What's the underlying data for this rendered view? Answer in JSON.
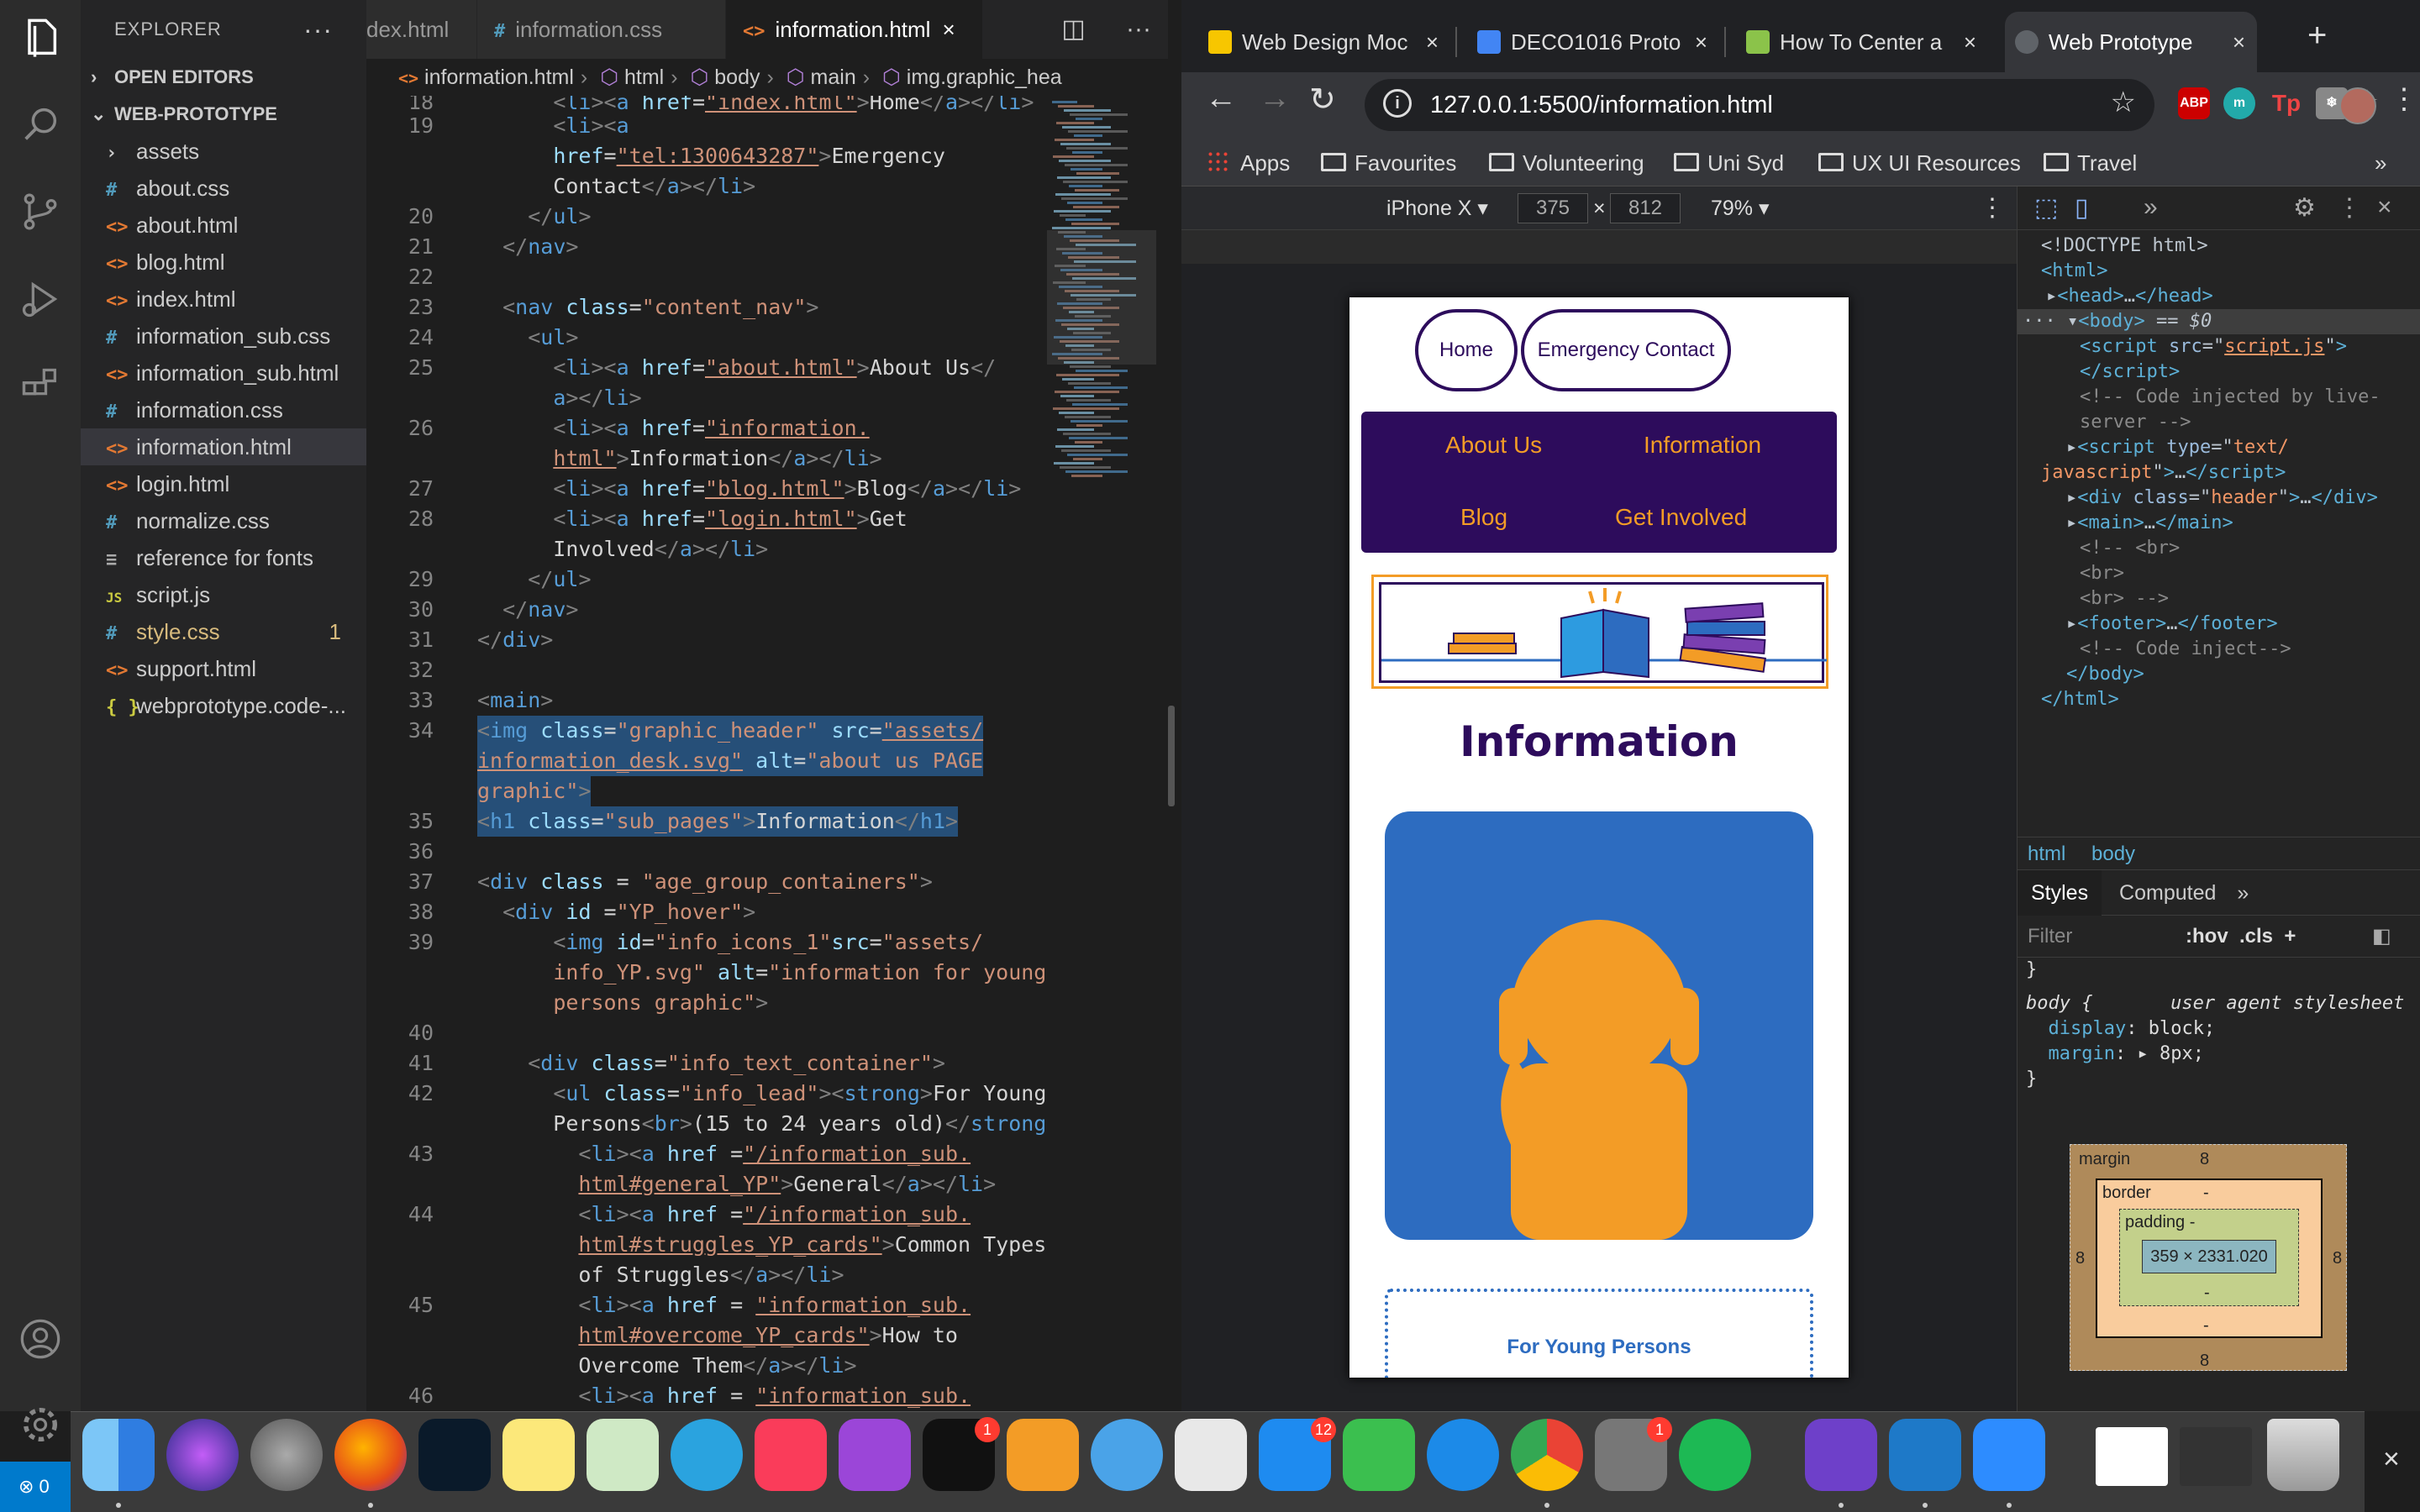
{
  "vscode": {
    "explorer_title": "EXPLORER",
    "open_editors": "OPEN EDITORS",
    "project": "WEB-PROTOTYPE",
    "files": [
      {
        "name": "assets",
        "type": "folder"
      },
      {
        "name": "about.css",
        "type": "css"
      },
      {
        "name": "about.html",
        "type": "html"
      },
      {
        "name": "blog.html",
        "type": "html"
      },
      {
        "name": "index.html",
        "type": "html"
      },
      {
        "name": "information_sub.css",
        "type": "css"
      },
      {
        "name": "information_sub.html",
        "type": "html"
      },
      {
        "name": "information.css",
        "type": "css"
      },
      {
        "name": "information.html",
        "type": "html"
      },
      {
        "name": "login.html",
        "type": "html"
      },
      {
        "name": "normalize.css",
        "type": "css"
      },
      {
        "name": "reference for fonts",
        "type": "txt"
      },
      {
        "name": "script.js",
        "type": "js"
      },
      {
        "name": "style.css",
        "type": "css",
        "badge": "1"
      },
      {
        "name": "support.html",
        "type": "html"
      },
      {
        "name": "webprototype.code-...",
        "type": "json"
      }
    ],
    "tabs": [
      {
        "label": "index.html",
        "icon": "<>",
        "partial": "dex.html"
      },
      {
        "label": "information.css",
        "icon": "#"
      },
      {
        "label": "information.html",
        "icon": "<>",
        "close": "×"
      }
    ],
    "breadcrumb": [
      "information.html",
      "html",
      "body",
      "main",
      "img.graphic_hea"
    ],
    "status": "⊗ 0"
  },
  "chrome": {
    "tabs": [
      {
        "title": "Web Design Moc",
        "color": "#f7c600"
      },
      {
        "title": "DECO1016 Proto",
        "color": "#4285f4"
      },
      {
        "title": "How To Center a",
        "color": "#8bc34a"
      },
      {
        "title": "Web Prototype",
        "color": "#5f6368"
      }
    ],
    "url": "127.0.0.1:5500/information.html",
    "extensions": [
      {
        "label": "ABP",
        "color": "#c00"
      },
      {
        "label": "m",
        "color": "#2aa"
      },
      {
        "label": "Tp",
        "color": "#e44"
      },
      {
        "label": "❄",
        "color": "#888"
      }
    ],
    "bookmarks": [
      "Apps",
      "Favourites",
      "Volunteering",
      "Uni Syd",
      "UX UI Resources",
      "Travel"
    ],
    "device": {
      "name": "iPhone X ▾",
      "width": "375",
      "x": "×",
      "height": "812",
      "zoom": "79% ▾"
    }
  },
  "page": {
    "nav_pills": [
      "Home",
      "Emergency Contact"
    ],
    "content_nav": [
      "About Us",
      "Information",
      "Blog",
      "Get Involved"
    ],
    "title": "Information",
    "yp_lead": "For Young Persons"
  },
  "devtools": {
    "crumbs": [
      "html",
      "body"
    ],
    "tabs": [
      "Styles",
      "Computed",
      "»"
    ],
    "filter": "Filter",
    "filter_opts": ":hov  .cls  +",
    "box": {
      "margin_label": "margin",
      "margin": "8",
      "border_label": "border",
      "border": "-",
      "padding_label": "padding -",
      "content": "359 × 2331.020",
      "dash": "-"
    }
  }
}
